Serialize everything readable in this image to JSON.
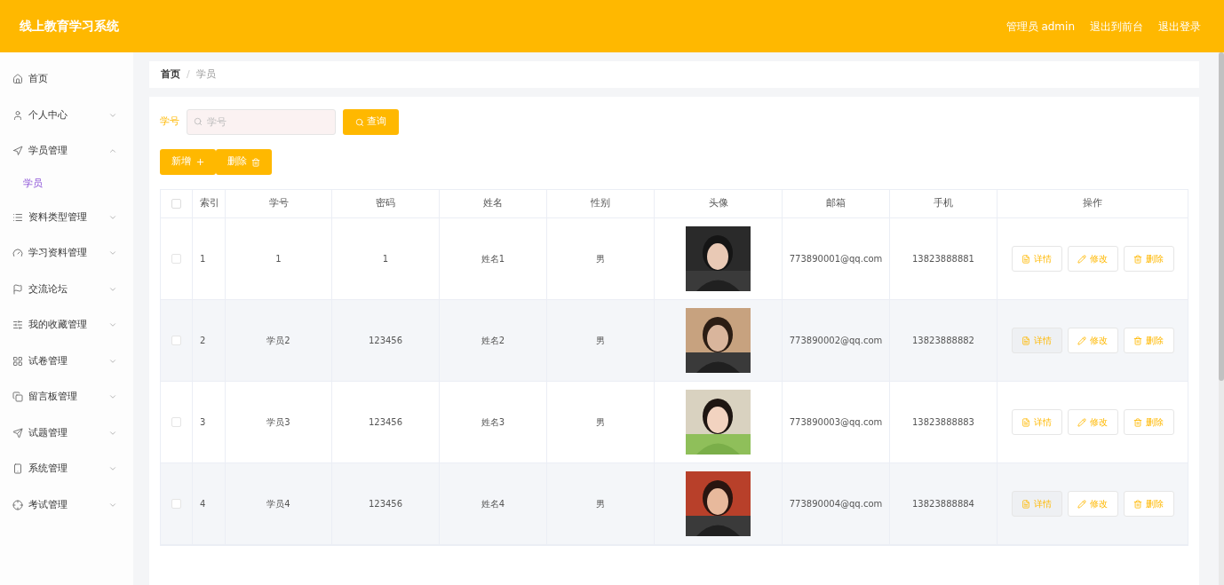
{
  "header": {
    "title": "线上教育学习系统",
    "links": [
      "管理员 admin",
      "退出到前台",
      "退出登录"
    ]
  },
  "sidebar": {
    "items": [
      {
        "label": "首页",
        "kind": "link"
      },
      {
        "label": "个人中心",
        "kind": "menu",
        "expanded": false
      },
      {
        "label": "学员管理",
        "kind": "menu",
        "expanded": true,
        "children": [
          {
            "label": "学员",
            "selected": true
          }
        ]
      },
      {
        "label": "资料类型管理",
        "kind": "menu",
        "expanded": false
      },
      {
        "label": "学习资料管理",
        "kind": "menu",
        "expanded": false
      },
      {
        "label": "交流论坛",
        "kind": "menu",
        "expanded": false
      },
      {
        "label": "我的收藏管理",
        "kind": "menu",
        "expanded": false
      },
      {
        "label": "试卷管理",
        "kind": "menu",
        "expanded": false
      },
      {
        "label": "留言板管理",
        "kind": "menu",
        "expanded": false
      },
      {
        "label": "试题管理",
        "kind": "menu",
        "expanded": false
      },
      {
        "label": "系统管理",
        "kind": "menu",
        "expanded": false
      },
      {
        "label": "考试管理",
        "kind": "menu",
        "expanded": false
      }
    ]
  },
  "breadcrumb": {
    "items": [
      "首页",
      "学员"
    ],
    "separator": "/"
  },
  "search": {
    "label": "学号",
    "placeholder": "学号",
    "button": "查询"
  },
  "actions": [
    "新增",
    "删除"
  ],
  "table": {
    "all_checked": false,
    "columns": [
      "索引",
      "学号",
      "密码",
      "姓名",
      "性别",
      "头像",
      "邮箱",
      "手机",
      "操作"
    ],
    "rows": [
      {
        "checked": false,
        "cells": [
          "1",
          "1",
          "1",
          "姓名1",
          "男"
        ],
        "avatar": {
          "kind": "picture"
        },
        "email": "773890001@qq.com",
        "phone": "13823888881",
        "buttons": [
          "详情",
          "修改",
          "删除"
        ]
      },
      {
        "checked": false,
        "cells": [
          "2",
          "学员2",
          "123456",
          "姓名2",
          "男"
        ],
        "avatar": {
          "kind": "picture"
        },
        "email": "773890002@qq.com",
        "phone": "13823888882",
        "buttons": [
          "详情",
          "修改",
          "删除"
        ]
      },
      {
        "checked": false,
        "cells": [
          "3",
          "学员3",
          "123456",
          "姓名3",
          "男"
        ],
        "avatar": {
          "kind": "picture"
        },
        "email": "773890003@qq.com",
        "phone": "13823888883",
        "buttons": [
          "详情",
          "修改",
          "删除"
        ]
      },
      {
        "checked": false,
        "cells": [
          "4",
          "学员4",
          "123456",
          "姓名4",
          "男"
        ],
        "avatar": {
          "kind": "picture"
        },
        "email": "773890004@qq.com",
        "phone": "13823888884",
        "buttons": [
          "详情",
          "修改",
          "删除"
        ]
      }
    ]
  }
}
